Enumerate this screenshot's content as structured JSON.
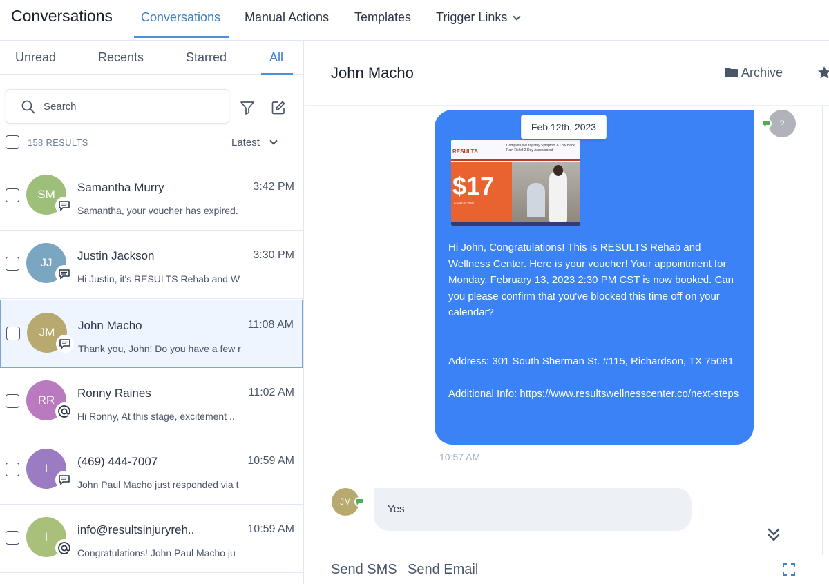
{
  "app": {
    "title": "Conversations",
    "nav": [
      "Conversations",
      "Manual Actions",
      "Templates",
      "Trigger Links"
    ]
  },
  "filters": {
    "tabs": [
      "Unread",
      "Recents",
      "Starred",
      "All"
    ],
    "active": "All"
  },
  "search": {
    "placeholder": "Search"
  },
  "list": {
    "results": "158 RESULTS",
    "sort": "Latest",
    "rows": [
      {
        "initials": "SM",
        "name": "Samantha Murry",
        "time": "3:42 PM",
        "preview": "Samantha, your voucher has expired.",
        "color": "#9dbf7a",
        "channel": "sms-icon"
      },
      {
        "initials": "JJ",
        "name": "Justin Jackson",
        "time": "3:30 PM",
        "preview": "Hi Justin, it's RESULTS Rehab and We",
        "color": "#7aa6c2",
        "channel": "sms-icon"
      },
      {
        "initials": "JM",
        "name": "John Macho",
        "time": "11:08 AM",
        "preview": "Thank you, John! Do you have a few r",
        "color": "#b8a96e",
        "channel": "sms-icon"
      },
      {
        "initials": "RR",
        "name": "Ronny Raines",
        "time": "11:02 AM",
        "preview": "Hi Ronny, At this stage, excitement ..",
        "color": "#b97ac0",
        "channel": "email-icon"
      },
      {
        "initials": "I",
        "name": "(469) 444-7007",
        "time": "10:59 AM",
        "preview": "John Paul Macho just responded via t",
        "color": "#9b7cc2",
        "channel": "sms-icon"
      },
      {
        "initials": "I",
        "name": "info@resultsinjuryreh..",
        "time": "10:59 AM",
        "preview": "Congratulations! John Paul Macho ju",
        "color": "#a9c07a",
        "channel": "email-icon"
      }
    ]
  },
  "chat": {
    "contact": "John Macho",
    "archive_label": "Archive",
    "date_chip": "Feb 12th, 2023",
    "agent_avatar": "?",
    "voucher": {
      "brand": "RESULTS",
      "headline": "Complete Neuropathy Symptom & Low Back Pain Relief 2-Day Assessment",
      "price": "$17",
      "value": "A $244.00 Value"
    },
    "outgoing_text": "Hi John, Congratulations! This is RESULTS Rehab and Wellness Center. Here is your voucher! Your appointment for Monday, February 13, 2023 2:30 PM CST is now booked. Can you please confirm that you've blocked this time off on your calendar?\n\n\nAddress: 301 South Sherman St. #115, Richardson, TX 75081\n\nAdditional Info: ",
    "outgoing_link": "https://www.resultswellnesscenter.co/next-steps",
    "outgoing_time": "10:57 AM",
    "incoming_initials": "JM",
    "incoming_text": "Yes",
    "composer_tabs": [
      "Send SMS",
      "Send Email"
    ]
  },
  "colors": {
    "accent": "#3b82c4",
    "bubble_out": "#3b82f6",
    "bubble_in": "#edf0f5",
    "badge_green": "#4caf50"
  }
}
